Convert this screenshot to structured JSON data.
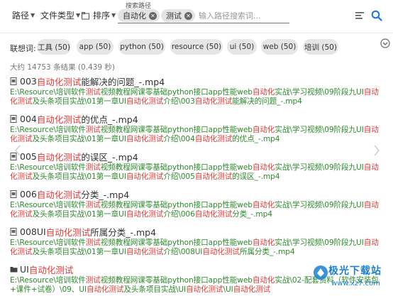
{
  "filters": {
    "path_label": "路径",
    "type_label": "文件类型",
    "sort_label": "排序",
    "search_path_label": "搜索路径",
    "chips": [
      "自动化",
      "测试"
    ],
    "placeholder": "输入路径搜索词..."
  },
  "related": {
    "label": "联想词:",
    "chips": [
      "工具 (50)",
      "app (50)",
      "python (50)",
      "resource (50)",
      "ui (50)",
      "web (50)",
      "培训 (50)"
    ]
  },
  "result_count": "大约 14753 条结果 (0.439 秒)",
  "results": [
    {
      "icon": "file-icon",
      "title": [
        [
          "003",
          false
        ],
        [
          "自动化测试",
          true
        ],
        [
          "能解决的问题_-.mp4",
          false
        ]
      ],
      "path": [
        [
          "E:\\Resource\\培训软件",
          false
        ],
        [
          "测试",
          true
        ],
        [
          "视频教程网课零基础python接口app性能web",
          false
        ],
        [
          "自动化",
          true
        ],
        [
          "实战\\学习视频\\09阶段九UI",
          false
        ],
        [
          "自动化测试",
          true
        ],
        [
          "及头条项目实战\\01第一章UI",
          false
        ],
        [
          "自动化测试",
          true
        ],
        [
          "介绍\\003",
          false
        ],
        [
          "自动化测试",
          true
        ],
        [
          "能解决的问题_-.mp4",
          false
        ]
      ]
    },
    {
      "icon": "file-icon",
      "title": [
        [
          "004",
          false
        ],
        [
          "自动化测试",
          true
        ],
        [
          "的优点_-.mp4",
          false
        ]
      ],
      "path": [
        [
          "E:\\Resource\\培训软件",
          false
        ],
        [
          "测试",
          true
        ],
        [
          "视频教程网课零基础python接口app性能web",
          false
        ],
        [
          "自动化",
          true
        ],
        [
          "实战\\学习视频\\09阶段九UI",
          false
        ],
        [
          "自动化测试",
          true
        ],
        [
          "及头条项目实战\\01第一章UI",
          false
        ],
        [
          "自动化测试",
          true
        ],
        [
          "介绍\\004",
          false
        ],
        [
          "自动化测试",
          true
        ],
        [
          "的优点_-.mp4",
          false
        ]
      ]
    },
    {
      "icon": "file-icon",
      "title": [
        [
          "005",
          false
        ],
        [
          "自动化测试",
          true
        ],
        [
          "的误区_-.mp4",
          false
        ]
      ],
      "path": [
        [
          "E:\\Resource\\培训软件",
          false
        ],
        [
          "测试",
          true
        ],
        [
          "视频教程网课零基础python接口app性能web",
          false
        ],
        [
          "自动化",
          true
        ],
        [
          "实战\\学习视频\\09阶段九UI",
          false
        ],
        [
          "自动化测试",
          true
        ],
        [
          "及头条项目实战\\01第一章UI",
          false
        ],
        [
          "自动化测试",
          true
        ],
        [
          "介绍\\005",
          false
        ],
        [
          "自动化测试",
          true
        ],
        [
          "的误区_-.mp4",
          false
        ]
      ]
    },
    {
      "icon": "file-icon",
      "title": [
        [
          "006",
          false
        ],
        [
          "自动化测试",
          true
        ],
        [
          "分类_-.mp4",
          false
        ]
      ],
      "path": [
        [
          "E:\\Resource\\培训软件",
          false
        ],
        [
          "测试",
          true
        ],
        [
          "视频教程网课零基础python接口app性能web",
          false
        ],
        [
          "自动化",
          true
        ],
        [
          "实战\\学习视频\\09阶段九UI",
          false
        ],
        [
          "自动化测试",
          true
        ],
        [
          "及头条项目实战\\01第一章UI",
          false
        ],
        [
          "自动化测试",
          true
        ],
        [
          "介绍\\006",
          false
        ],
        [
          "自动化测试",
          true
        ],
        [
          "分类_-.mp4",
          false
        ]
      ]
    },
    {
      "icon": "file-icon",
      "title": [
        [
          "008UI",
          false
        ],
        [
          "自动化测试",
          true
        ],
        [
          "所属分类_-.mp4",
          false
        ]
      ],
      "path": [
        [
          "E:\\Resource\\培训软件",
          false
        ],
        [
          "测试",
          true
        ],
        [
          "视频教程网课零基础python接口app性能web",
          false
        ],
        [
          "自动化",
          true
        ],
        [
          "实战\\学习视频\\09阶段九UI",
          false
        ],
        [
          "自动化测试",
          true
        ],
        [
          "及头条项目实战\\01第一章UI",
          false
        ],
        [
          "自动化测试",
          true
        ],
        [
          "介绍\\008UI",
          false
        ],
        [
          "自动化测试",
          true
        ],
        [
          "所属分类_-.mp4",
          false
        ]
      ]
    },
    {
      "icon": "folder-icon",
      "title": [
        [
          "UI",
          false
        ],
        [
          "自动化测试",
          true
        ]
      ],
      "path": [
        [
          "E:\\Resource\\培训软件",
          false
        ],
        [
          "测试",
          true
        ],
        [
          "视频教程网课零基础python接口app性能web",
          false
        ],
        [
          "自动化",
          true
        ],
        [
          "实战\\02-配套资料（软件安装包+课件+试卷）\\09、UI",
          false
        ],
        [
          "自动化测试",
          true
        ],
        [
          "及头条项目实战\\UI",
          false
        ],
        [
          "自动化测试",
          true
        ],
        [
          "\\UI",
          false
        ],
        [
          "自动化测试",
          true
        ]
      ]
    }
  ],
  "watermark": {
    "text": "极光下载站",
    "sub": "www.xz7.com"
  },
  "colors": {
    "accent": "#1a73e8",
    "highlight": "#e53935",
    "path": "#2e8b2e"
  }
}
